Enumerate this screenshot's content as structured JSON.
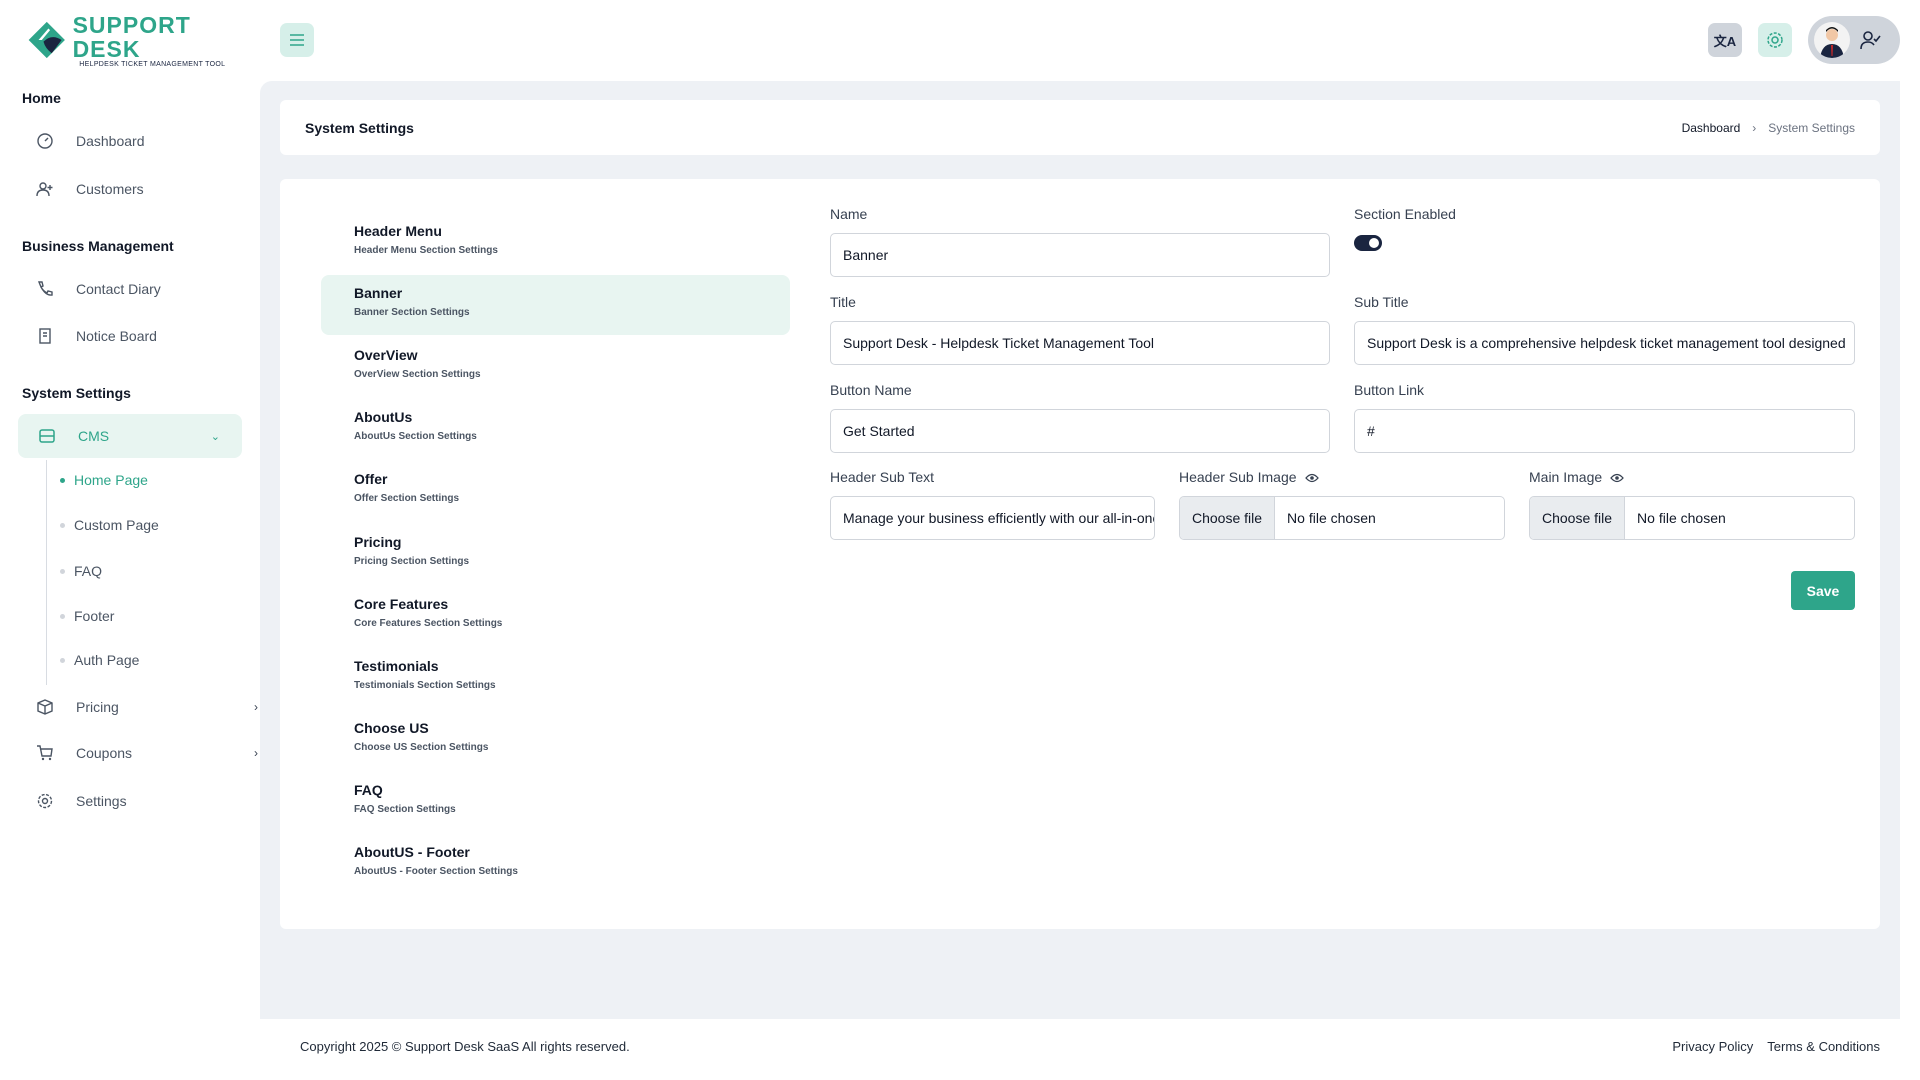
{
  "brand": {
    "name": "SUPPORT DESK",
    "tagline": "HELPDESK TICKET MANAGEMENT TOOL",
    "accent": "#2ea58a",
    "dark": "#1a2540"
  },
  "sidebar": {
    "sections": [
      "Home",
      "Business Management",
      "System Settings"
    ],
    "items": {
      "dashboard": "Dashboard",
      "customers": "Customers",
      "contact_diary": "Contact Diary",
      "notice_board": "Notice Board",
      "cms": "CMS",
      "pricing": "Pricing",
      "coupons": "Coupons",
      "settings": "Settings"
    },
    "cms_sub": [
      "Home Page",
      "Custom Page",
      "FAQ",
      "Footer",
      "Auth Page"
    ]
  },
  "header": {
    "title": "System Settings",
    "breadcrumb": [
      "Dashboard",
      "System Settings"
    ]
  },
  "sections": [
    {
      "title": "Header Menu",
      "sub": "Header Menu Section Settings"
    },
    {
      "title": "Banner",
      "sub": "Banner Section Settings"
    },
    {
      "title": "OverView",
      "sub": "OverView Section Settings"
    },
    {
      "title": "AboutUs",
      "sub": "AboutUs Section Settings"
    },
    {
      "title": "Offer",
      "sub": "Offer Section Settings"
    },
    {
      "title": "Pricing",
      "sub": "Pricing Section Settings"
    },
    {
      "title": "Core Features",
      "sub": "Core Features Section Settings"
    },
    {
      "title": "Testimonials",
      "sub": "Testimonials Section Settings"
    },
    {
      "title": "Choose US",
      "sub": "Choose US Section Settings"
    },
    {
      "title": "FAQ",
      "sub": "FAQ Section Settings"
    },
    {
      "title": "AboutUS - Footer",
      "sub": "AboutUS - Footer Section Settings"
    }
  ],
  "form": {
    "name_label": "Name",
    "name": "Banner",
    "enabled_label": "Section Enabled",
    "enabled": true,
    "title_label": "Title",
    "title": "Support Desk - Helpdesk Ticket Management Tool",
    "subtitle_label": "Sub Title",
    "subtitle": "Support Desk is a comprehensive helpdesk ticket management tool designed",
    "button_name_label": "Button Name",
    "button_name": "Get Started",
    "button_link_label": "Button Link",
    "button_link": "#",
    "sub_text_label": "Header Sub Text",
    "sub_text": "Manage your business efficiently with our all-in-one",
    "sub_image_label": "Header Sub Image",
    "main_image_label": "Main Image",
    "choose_file": "Choose file",
    "no_file": "No file chosen",
    "save": "Save"
  },
  "footer": {
    "copyright": "Copyright 2025 © Support Desk SaaS All rights reserved.",
    "privacy": "Privacy Policy",
    "terms": "Terms & Conditions"
  }
}
